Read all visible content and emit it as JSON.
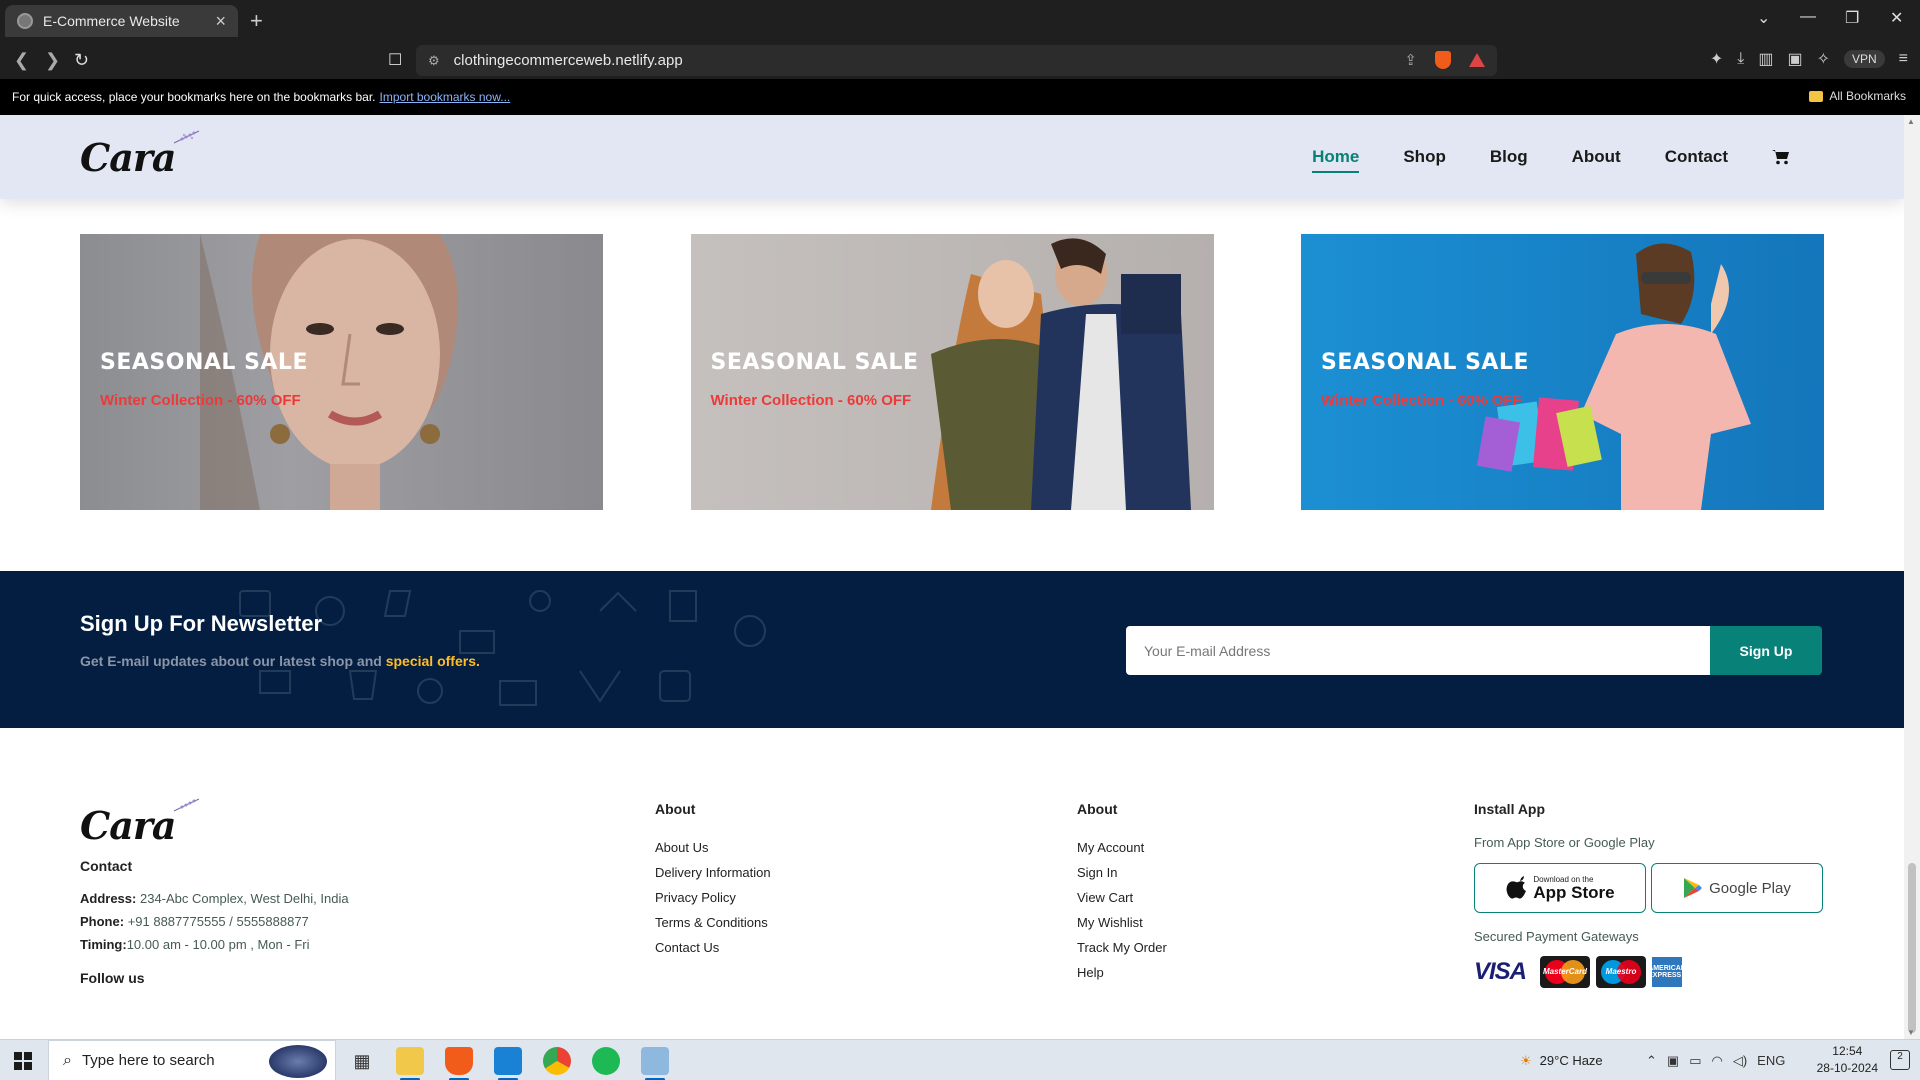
{
  "browser": {
    "tab_title": "E-Commerce Website",
    "url": "clothingecommerceweb.netlify.app",
    "vpn_label": "VPN",
    "bookmarks_prompt": "For quick access, place your bookmarks here on the bookmarks bar.",
    "import_link": "Import bookmarks now...",
    "all_bookmarks": "All Bookmarks"
  },
  "site": {
    "logo": "Cara",
    "nav": [
      {
        "label": "Home",
        "active": true
      },
      {
        "label": "Shop",
        "active": false
      },
      {
        "label": "Blog",
        "active": false
      },
      {
        "label": "About",
        "active": false
      },
      {
        "label": "Contact",
        "active": false
      }
    ],
    "accent_color": "#088178"
  },
  "banners": [
    {
      "title": "SEASONAL SALE",
      "subtitle": "Winter Collection - 60% OFF"
    },
    {
      "title": "SEASONAL SALE",
      "subtitle": "Winter Collection - 60% OFF"
    },
    {
      "title": "SEASONAL SALE",
      "subtitle": "Winter Collection - 60% OFF"
    }
  ],
  "newsletter": {
    "title": "Sign Up For Newsletter",
    "subtitle_prefix": "Get E-mail updates about our latest shop and",
    "subtitle_highlight": "special offers.",
    "email_placeholder": "Your E-mail Address",
    "button": "Sign Up"
  },
  "footer": {
    "contact_heading": "Contact",
    "address_label": "Address:",
    "address": "234-Abc Complex, West Delhi, India",
    "phone_label": "Phone:",
    "phone": "+91 8887775555 / 5555888877",
    "timing_label": "Timing:",
    "timing": "10.00 am - 10.00 pm , Mon - Fri",
    "follow_heading": "Follow us",
    "about_col": {
      "heading": "About",
      "links": [
        "About Us",
        "Delivery Information",
        "Privacy Policy",
        "Terms & Conditions",
        "Contact Us"
      ]
    },
    "account_col": {
      "heading": "About",
      "links": [
        "My Account",
        "Sign In",
        "View Cart",
        "My Wishlist",
        "Track My Order",
        "Help"
      ]
    },
    "app_col": {
      "heading": "Install App",
      "subtitle": "From App Store or Google Play",
      "appstore_small": "Download on the",
      "appstore_big": "App Store",
      "googleplay": "Google Play",
      "payments_heading": "Secured Payment Gateways",
      "visa": "VISA",
      "mastercard": "MasterCard",
      "maestro": "Maestro",
      "amex": "AMERICAN EXPRESS"
    }
  },
  "taskbar": {
    "search_placeholder": "Type here to search",
    "weather": "29°C  Haze",
    "lang": "ENG",
    "time": "12:54",
    "date": "28-10-2024",
    "notifications": "2"
  }
}
